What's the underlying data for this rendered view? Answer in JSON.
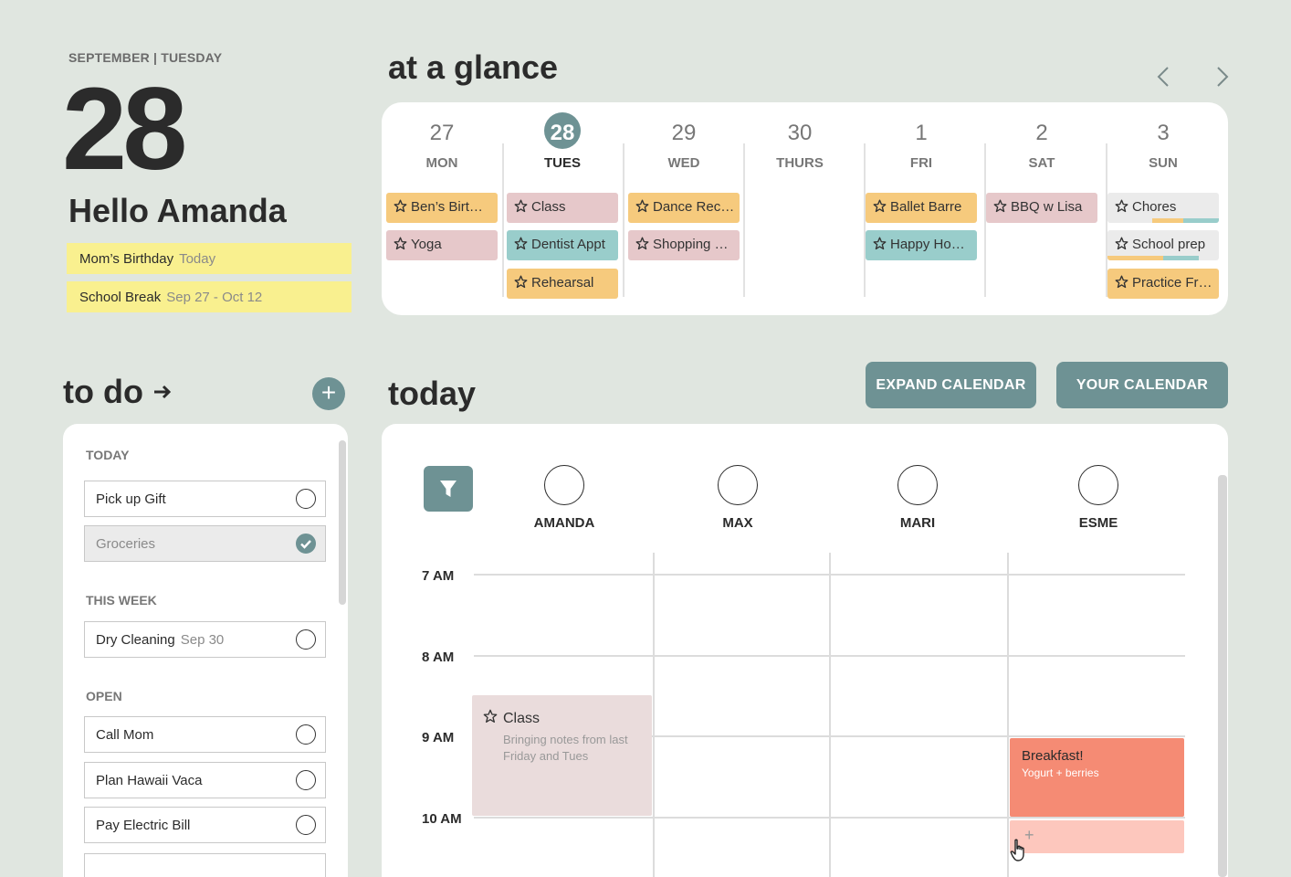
{
  "header": {
    "dateline": "SEPTEMBER | TUESDAY",
    "day_number": "28",
    "greeting": "Hello Amanda"
  },
  "notes": [
    {
      "title": "Mom’s Birthday",
      "sub": "Today"
    },
    {
      "title": "School Break",
      "sub": "Sep 27 - Oct 12"
    }
  ],
  "glance": {
    "title": "at a glance",
    "prev_icon": "chevron-left-icon",
    "next_icon": "chevron-right-icon",
    "days": [
      {
        "num": "27",
        "name": "MON",
        "today": false,
        "events": [
          {
            "label": "Ben’s Birt…",
            "color": "orange"
          },
          {
            "label": "Yoga",
            "color": "pink"
          }
        ]
      },
      {
        "num": "28",
        "name": "TUES",
        "today": true,
        "events": [
          {
            "label": "Class",
            "color": "pink"
          },
          {
            "label": "Dentist Appt",
            "color": "teal"
          },
          {
            "label": "Rehearsal",
            "color": "orange"
          }
        ]
      },
      {
        "num": "29",
        "name": "WED",
        "today": false,
        "events": [
          {
            "label": "Dance Rec…",
            "color": "orange"
          },
          {
            "label": "Shopping …",
            "color": "pink"
          }
        ]
      },
      {
        "num": "30",
        "name": "THURS",
        "today": false,
        "events": []
      },
      {
        "num": "1",
        "name": "FRI",
        "today": false,
        "events": [
          {
            "label": "Ballet Barre",
            "color": "orange"
          },
          {
            "label": "Happy Ho…",
            "color": "teal"
          }
        ]
      },
      {
        "num": "2",
        "name": "SAT",
        "today": false,
        "events": [
          {
            "label": "BBQ w Lisa",
            "color": "pink"
          }
        ]
      },
      {
        "num": "3",
        "name": "SUN",
        "today": false,
        "events": [
          {
            "label": "Chores",
            "color": "gray",
            "stripes": [
              "orange",
              "teal"
            ]
          },
          {
            "label": "School prep",
            "color": "gray",
            "stripes": [
              "orange",
              "teal"
            ]
          },
          {
            "label": "Practice Fr…",
            "color": "orange"
          }
        ]
      }
    ]
  },
  "todo": {
    "title": "to do",
    "arrow": "→",
    "add_label": "+",
    "groups": [
      {
        "label": "TODAY",
        "items": [
          {
            "title": "Pick up Gift",
            "sub": "",
            "done": false
          },
          {
            "title": "Groceries",
            "sub": "",
            "done": true
          }
        ]
      },
      {
        "label": "THIS WEEK",
        "items": [
          {
            "title": "Dry Cleaning",
            "sub": "Sep 30",
            "done": false
          }
        ]
      },
      {
        "label": "OPEN",
        "items": [
          {
            "title": "Call Mom",
            "sub": "",
            "done": false
          },
          {
            "title": "Plan Hawaii Vaca",
            "sub": "",
            "done": false
          },
          {
            "title": "Pay Electric Bill",
            "sub": "",
            "done": false
          }
        ]
      }
    ]
  },
  "today": {
    "title": "today",
    "expand_label": "EXPAND CALENDAR",
    "your_label": "YOUR CALENDAR",
    "people": [
      "AMANDA",
      "MAX",
      "MARI",
      "ESME"
    ],
    "hours": [
      "7 AM",
      "8 AM",
      "9 AM",
      "10 AM"
    ],
    "events": [
      {
        "title": "Class",
        "desc": "Bringing notes from last Friday and Tues"
      },
      {
        "title": "Breakfast!",
        "desc": "Yogurt + berries"
      }
    ],
    "add_slot_label": "+"
  },
  "colors": {
    "accent": "#6e9294",
    "orange": "#f6ca7d",
    "pink": "#e6c8ca",
    "teal": "#99cdcb",
    "gray": "#ebebeb",
    "note_yellow": "#f9f08f",
    "breakfast": "#f58b74",
    "class_event": "#eadcdc"
  }
}
